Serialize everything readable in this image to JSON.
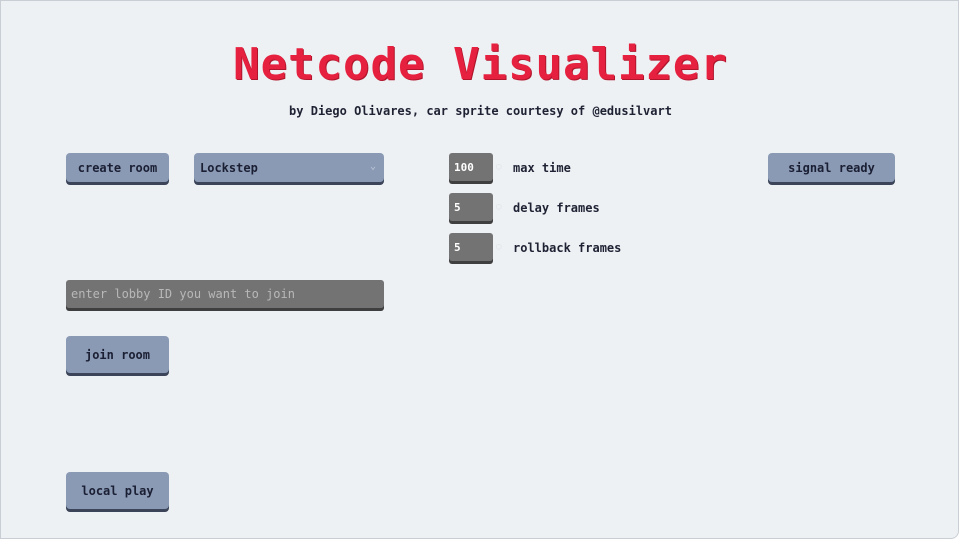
{
  "header": {
    "title": "Netcode Visualizer",
    "subtitle": "by Diego Olivares, car sprite courtesy of @edusilvart"
  },
  "controls": {
    "create_room_label": "create room",
    "mode_select": {
      "selected": "Lockstep"
    },
    "signal_ready_label": "signal ready",
    "join_room_label": "join room",
    "local_play_label": "local play",
    "lobby_input": {
      "value": "",
      "placeholder": "enter lobby ID you want to join"
    }
  },
  "settings": [
    {
      "value": "100",
      "label": "max time"
    },
    {
      "value": "5",
      "label": "delay frames"
    },
    {
      "value": "5",
      "label": "rollback frames"
    }
  ],
  "colors": {
    "title": "#e6213f",
    "button": "#8a9ab5",
    "background": "#edf1f4",
    "input": "#737373"
  }
}
